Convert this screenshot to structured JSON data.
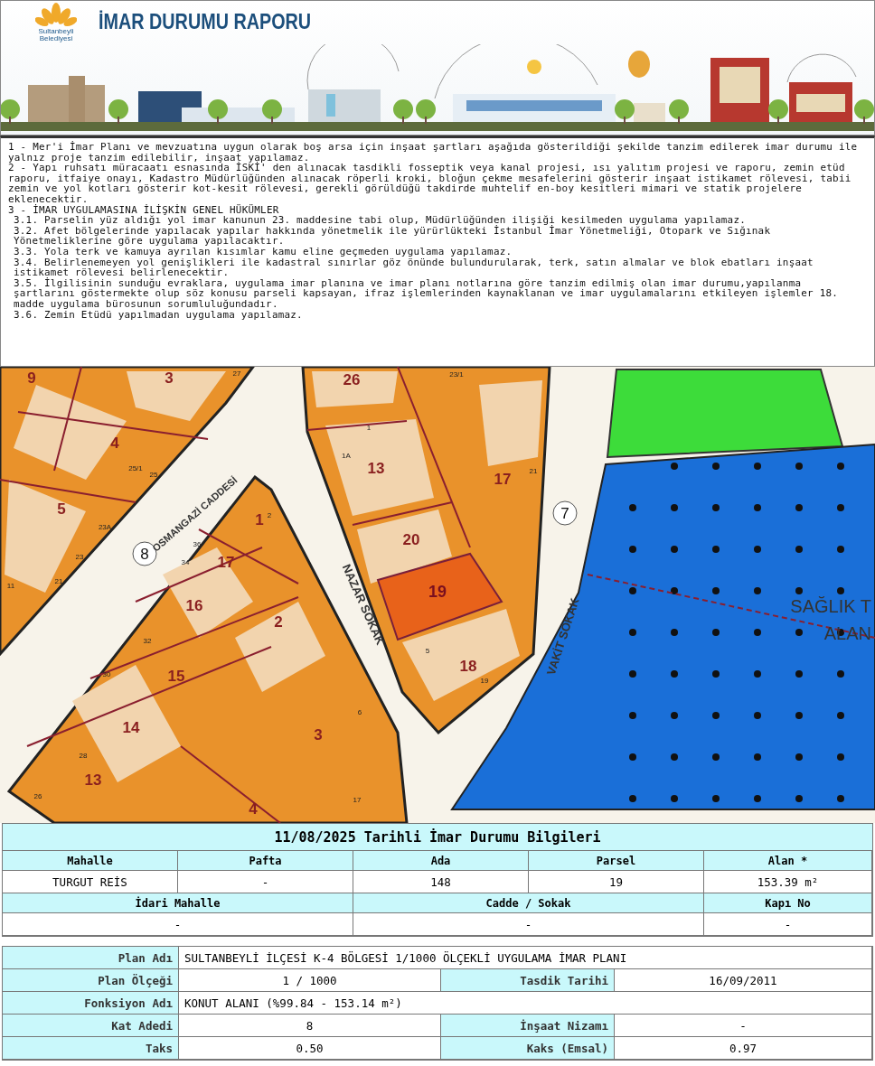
{
  "header": {
    "logo_text": [
      "Sultanbeyli",
      "Belediyesi"
    ],
    "title": "İMAR DURUMU RAPORU"
  },
  "notes": [
    {
      "kind": "item",
      "text": "1 - Mer'i İmar Planı ve mevzuatına uygun olarak boş arsa için inşaat şartları aşağıda gösterildiği şekilde tanzim edilerek imar durumu ile yalnız proje tanzim edilebilir, inşaat yapılamaz."
    },
    {
      "kind": "item",
      "text": "2 - Yapı ruhsatı müracaatı esnasında İSKİ' den alınacak tasdikli fosseptik veya kanal projesi, ısı yalıtım projesi ve raporu, zemin etüd raporu, itfaiye onayı, Kadastro Müdürlüğünden alınacak röperli kroki, bloğun çekme mesafelerini gösterir inşaat istikamet rölevesi, tabii zemin ve yol kotları gösterir kot-kesit rölevesi, gerekli görüldüğü takdirde muhtelif en-boy kesitleri mimari ve statik projelere eklenecektir."
    },
    {
      "kind": "item",
      "text": "3 - İMAR UYGULAMASINA İLİŞKİN GENEL HÜKÜMLER"
    },
    {
      "kind": "sub",
      "text": "3.1. Parselin yüz aldığı yol imar kanunun 23. maddesine tabi olup, Müdürlüğünden ilişiği kesilmeden uygulama yapılamaz."
    },
    {
      "kind": "sub",
      "text": "3.2. Afet bölgelerinde yapılacak yapılar hakkında yönetmelik ile yürürlükteki İstanbul İmar Yönetmeliği, Otopark ve Sığınak Yönetmeliklerine göre uygulama yapılacaktır."
    },
    {
      "kind": "sub",
      "text": "3.3. Yola terk ve kamuya ayrılan kısımlar kamu eline geçmeden uygulama yapılamaz."
    },
    {
      "kind": "sub",
      "text": "3.4. Belirlenemeyen yol genişlikleri ile kadastral sınırlar göz önünde bulundurularak, terk, satın almalar ve blok ebatları inşaat istikamet rölevesi belirlenecektir."
    },
    {
      "kind": "sub",
      "text": "3.5. İlgilisinin sunduğu evraklara, uygulama imar planına ve imar planı notlarına göre tanzim edilmiş olan imar durumu,yapılanma şartlarını göstermekte olup söz konusu parseli kapsayan, ifraz işlemlerinden kaynaklanan ve imar uygulamalarını etkileyen işlemler 18. madde uygulama bürosunun sorumluluğundadır."
    },
    {
      "kind": "sub",
      "text": "3.6. Zemin Etüdü yapılmadan uygulama yapılamaz."
    }
  ],
  "map": {
    "parcels": [
      {
        "label": "9",
        "selected": false
      },
      {
        "label": "3",
        "selected": false
      },
      {
        "label": "4",
        "selected": false
      },
      {
        "label": "5",
        "selected": false
      },
      {
        "label": "1",
        "selected": false
      },
      {
        "label": "17",
        "selected": false
      },
      {
        "label": "16",
        "selected": false
      },
      {
        "label": "2",
        "selected": false
      },
      {
        "label": "15",
        "selected": false
      },
      {
        "label": "14",
        "selected": false
      },
      {
        "label": "13",
        "selected": false
      },
      {
        "label": "3",
        "selected": false
      },
      {
        "label": "4",
        "selected": false
      },
      {
        "label": "26",
        "selected": false
      },
      {
        "label": "13",
        "selected": false
      },
      {
        "label": "20",
        "selected": false
      },
      {
        "label": "19",
        "selected": true
      },
      {
        "label": "18",
        "selected": false
      },
      {
        "label": "17",
        "selected": false
      }
    ],
    "door_numbers": [
      "27",
      "25/1",
      "25",
      "23A",
      "23",
      "21",
      "11",
      "36",
      "34",
      "32",
      "30",
      "28",
      "26",
      "6",
      "17",
      "23/1",
      "1",
      "1A",
      "21",
      "5",
      "19",
      "2"
    ],
    "streets": [
      "OSMANGAZİ CADDESİ",
      "NAZAR SOKAK",
      "VAKİT SOKAK"
    ],
    "road_numbers": [
      "8",
      "7"
    ],
    "area_labels": [
      "SAĞLIK T",
      "ALAN"
    ]
  },
  "info_table": {
    "title": "11/08/2025 Tarihli İmar Durumu Bilgileri",
    "rows": [
      [
        "Mahalle",
        "Pafta",
        "Ada",
        "Parsel",
        "Alan *"
      ],
      [
        "TURGUT REİS",
        "-",
        "148",
        "19",
        "153.39 m²"
      ],
      [
        "İdari Mahalle",
        "Cadde / Sokak",
        "Kapı No"
      ],
      [
        "-",
        "-",
        "-"
      ]
    ]
  },
  "plan_table": [
    {
      "label": "Plan Adı",
      "value": "SULTANBEYLİ İLÇESİ K-4 BÖLGESİ 1/1000 ÖLÇEKLİ UYGULAMA İMAR PLANI"
    },
    {
      "label": "Plan Ölçeği",
      "value": "1 / 1000",
      "label2": "Tasdik Tarihi",
      "value2": "16/09/2011"
    },
    {
      "label": "Fonksiyon Adı",
      "value": "KONUT ALANI (%99.84 - 153.14 m²)"
    },
    {
      "label": "Kat Adedi",
      "value": "8",
      "label2": "İnşaat Nizamı",
      "value2": "-"
    },
    {
      "label": "Taks",
      "value": "0.50",
      "label2": "Kaks (Emsal)",
      "value2": "0.97"
    }
  ]
}
